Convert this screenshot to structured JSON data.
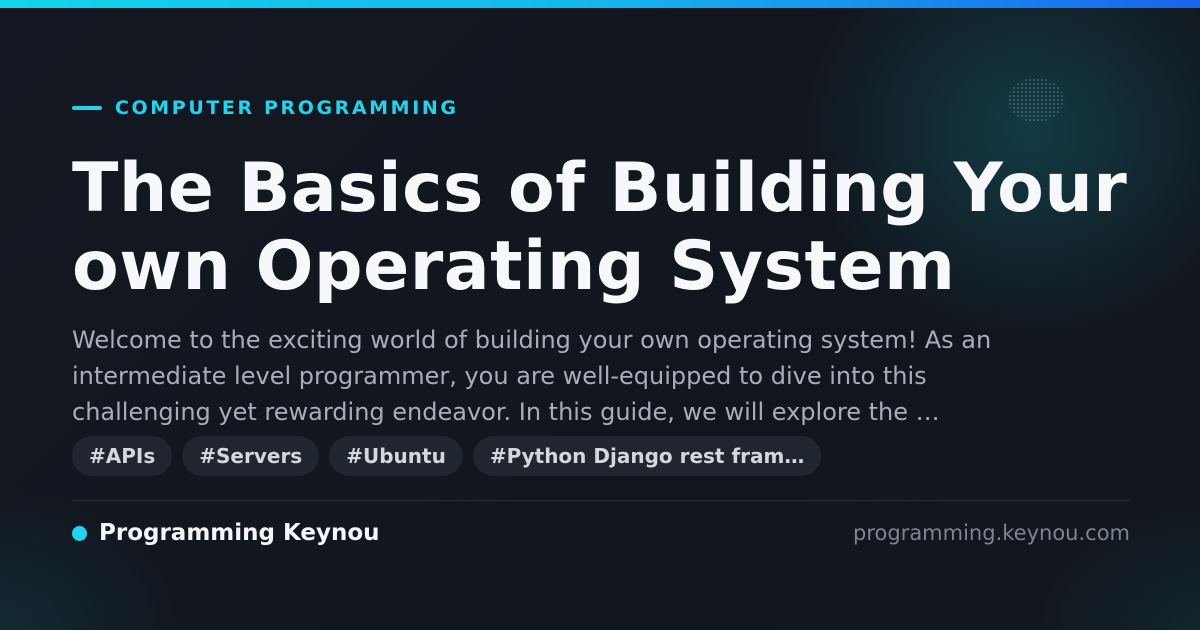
{
  "category": "COMPUTER PROGRAMMING",
  "title": "The Basics of Building Your own Operating System",
  "summary": "Welcome to the exciting world of building your own operating system! As an intermediate level programmer, you are well-equipped to dive into this challenging yet rewarding endeavor. In this guide, we will explore the …",
  "tags": [
    "#APIs",
    "#Servers",
    "#Ubuntu",
    "#Python Django rest fram…"
  ],
  "brand": {
    "name": "Programming Keynou",
    "domain": "programming.keynou.com"
  },
  "colors": {
    "accent": "#22d3ee",
    "background": "#12161f",
    "tag_bg": "#1f2630"
  },
  "icons": {
    "category_marker": "dash-icon",
    "brand_marker": "dot-icon"
  }
}
